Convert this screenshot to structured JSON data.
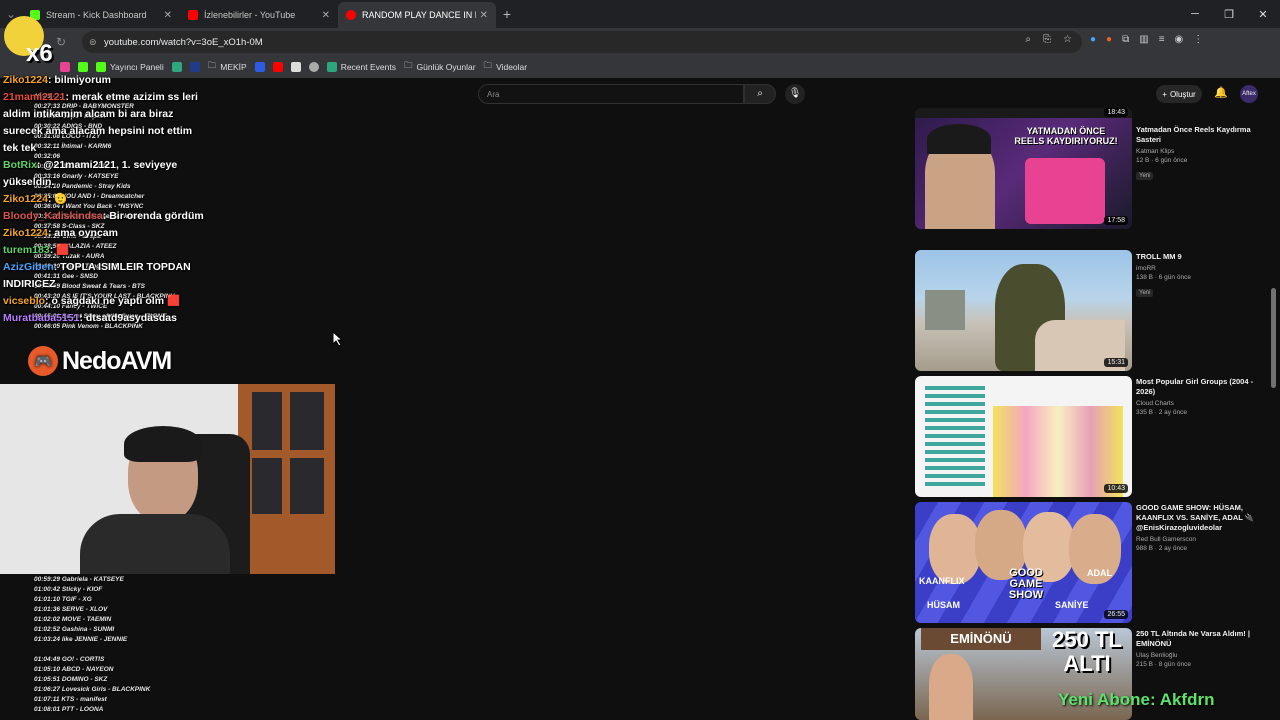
{
  "browser": {
    "tabs": [
      {
        "title": "Stream - Kick Dashboard",
        "color": "#53fc18"
      },
      {
        "title": "İzlenebilirler - YouTube",
        "color": "#ff0000"
      },
      {
        "title": "RANDOM PLAY DANCE IN PUB",
        "color": "#ff0000"
      }
    ],
    "url": "youtube.com/watch?v=3oE_xO1h-0M",
    "bookmarks": [
      "Yayıncı Paneli",
      "MEKİP",
      "Recent Events",
      "Günlük Oyunlar",
      "Videolar"
    ]
  },
  "youtube": {
    "search_placeholder": "Ara",
    "create_label": "Oluştur",
    "account_label": "Aftex",
    "videos": [
      {
        "title": "Yatmadan Önce Reels Kaydırma Sasteri",
        "channel": "Katman Klips",
        "stats": "12 B · 6 gün önce",
        "badge": "Yeni",
        "duration": "17:58",
        "thumb_text": "YATMADAN ÖNCE REELS KAYDIRIYORUZ!",
        "top_dur": "18:43"
      },
      {
        "title": "TROLL MM 9",
        "channel": "imoRR",
        "stats": "138 B · 6 gün önce",
        "badge": "Yeni",
        "duration": "15:31",
        "thumb_text": ""
      },
      {
        "title": "Most Popular Girl Groups (2004 - 2026)",
        "channel": "Cloud Charts",
        "stats": "335 B · 2 ay önce",
        "badge": "",
        "duration": "10:43",
        "thumb_text": ""
      },
      {
        "title": "GOOD GAME SHOW: HÜSAM, KAANFLIX VS. SANİYE, ADAL 🔌 @EnisKirazogluvideolar",
        "channel": "Red Bull Gamerscon",
        "stats": "988 B · 2 ay önce",
        "badge": "",
        "duration": "26:55",
        "thumb_text": "GOOD GAME SHOW",
        "names": [
          "KAANFLIX",
          "HÜSAM",
          "SANİYE",
          "ADAL"
        ]
      },
      {
        "title": "250 TL Altında Ne Varsa Aldım! | EMİNÖNÜ",
        "channel": "Ulaş Benlioğlu",
        "stats": "215 B · 8 gün önce",
        "badge": "",
        "duration": "",
        "thumb_text": "250 TL ALTI",
        "place": "EMİNÖNÜ"
      }
    ]
  },
  "stream_overlay": {
    "badge_text": "x6",
    "chat": [
      {
        "user": "Ziko1224",
        "msg": ": bilmiyorum",
        "color": "#f5a623"
      },
      {
        "user": "21mami2121",
        "msg": ": merak etme azizim ss leri aldim intikamim alcam bi ara biraz surecek ama alacam hepsini not ettim tek tek",
        "color": "#e74c3c"
      },
      {
        "user": "BotRix",
        "msg": ": @21mami2121, 1. seviyeye yükseldin.",
        "color": "#5fd36a"
      },
      {
        "user": "Ziko1224",
        "msg": ": 🫡",
        "color": "#f5a623"
      },
      {
        "user": "Bloody_Kaliskindsa",
        "msg": ": Bir orenda gördüm",
        "color": "#d9534f"
      },
      {
        "user": "Ziko1224",
        "msg": ": ama oyncam",
        "color": "#f5a623"
      },
      {
        "user": "turem183",
        "msg": ": 🟥",
        "color": "#5fd36a"
      },
      {
        "user": "AzizGiben",
        "msg": ": TOPLA ISIMLEIR TOPDAN INDIRICEZ",
        "color": "#4aa3ff"
      },
      {
        "user": "vicseblo",
        "msg": ": o sağdaki ne yaptı olm 🟥",
        "color": "#f5a623"
      },
      {
        "user": "Muratbaba5151",
        "msg": ": dtsatd9asydasdas",
        "color": "#b57cff"
      }
    ],
    "brand": "NedoAVM",
    "playlist_top": [
      "18:48 - ...",
      "00:27:33 DRIP - BABYMONSTER",
      "00:29:16 Oops - Kep1er",
      "00:30:22 ADIOS - BND",
      "00:31:08 LOCO - ITZY",
      "00:32:11 İhtimal - KARM6",
      "00:32:06",
      "00:33:11 WICKED - ADP",
      "00:33:16 Gnarly - KATSEYE",
      "00:34:10 Pandemic - Stray Kids",
      "00:35:03 YOU AND I - Dreamcatcher",
      "00:36:04 I Want You Back - *NSYNC",
      "00:37:15 Beat It - Michael Jackson",
      "00:37:58 S-Class - SKZ",
      "00:38:15 Girls - aespa",
      "00:38:50 HALAZIA - ATEEZ",
      "00:39:20 Tuzak - AURA",
      "00:40:10 Lemon Tang - H2H",
      "00:41:31 Gee - SNSD",
      "00:42:59 Blood Sweat & Tears - BTS",
      "00:43:20 AS IF IT'S YOUR LAST - BLACKPINK",
      "00:44:10 Fancy - TWICE",
      "00:45:01 Secret Story of the Swan - IZ*ONE",
      "00:46:05 Pink Venom - BLACKPINK"
    ],
    "playlist_bottom": [
      "00:59:29 Gabriela - KATSEYE",
      "01:00:42 Sticky - KIOF",
      "01:01:10 TGIF - XG",
      "01:01:36 SERVE - XLOV",
      "01:02:02 MOVE - TAEMIN",
      "01:02:52 Gashina - SUNMI",
      "01:03:24 like JENNIE - JENNIE",
      "",
      "01:04:49 GO! - CORTIS",
      "01:05:10 ABCD - NAYEON",
      "01:05:51 DOMINO - SKZ",
      "01:06:27 Lovesick Girls - BLACKPINK",
      "01:07:11 KTS - manifest",
      "01:08:01 PTT - LOONA"
    ],
    "subscriber": "Yeni Abone: Akfdrn"
  }
}
